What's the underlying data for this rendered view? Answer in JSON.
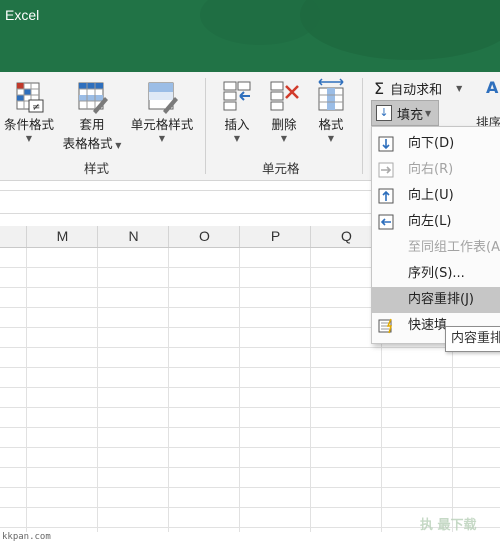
{
  "app": {
    "title": "Excel"
  },
  "ribbon": {
    "conditional_format": "条件格式",
    "table_format_line1": "套用",
    "table_format_line2": "表格格式",
    "cell_style": "单元格样式",
    "styles_group": "样式",
    "insert": "插入",
    "delete": "删除",
    "format": "格式",
    "cells_group": "单元格",
    "autosum": "自动求和",
    "fill": "填充",
    "sort_partial": "排序"
  },
  "columns": [
    "M",
    "N",
    "O",
    "P",
    "Q"
  ],
  "fill_menu": {
    "items": [
      {
        "label": "向下(D)",
        "state": "enabled",
        "icon": "fill-down-icon"
      },
      {
        "label": "向右(R)",
        "state": "disabled",
        "icon": "fill-right-icon"
      },
      {
        "label": "向上(U)",
        "state": "enabled",
        "icon": "fill-up-icon"
      },
      {
        "label": "向左(L)",
        "state": "enabled",
        "icon": "fill-left-icon"
      },
      {
        "label": "至同组工作表(A)",
        "state": "disabled",
        "icon": ""
      },
      {
        "label": "序列(S)...",
        "state": "enabled",
        "icon": ""
      },
      {
        "label": "内容重排(J)",
        "state": "hover",
        "icon": ""
      },
      {
        "label": "快速填",
        "state": "enabled",
        "icon": "flash-fill-icon"
      }
    ]
  },
  "tooltip": {
    "text": "内容重排"
  },
  "watermark": {
    "left": "kkpan.com",
    "right": "执 最下载"
  }
}
